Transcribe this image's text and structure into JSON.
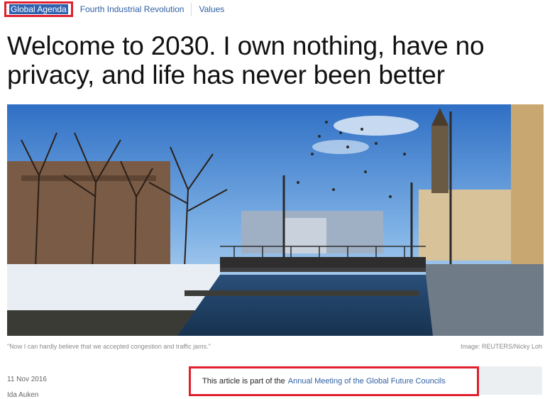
{
  "nav": {
    "items": [
      {
        "label": "Global Agenda"
      },
      {
        "label": "Fourth Industrial Revolution"
      },
      {
        "label": "Values"
      }
    ]
  },
  "article": {
    "title": "Welcome to 2030. I own nothing, have no privacy, and life has never been better",
    "image": {
      "caption": "\"Now I can hardly believe that we accepted congestion and traffic jams.\"",
      "credit": "Image: REUTERS/Nicky Loh"
    },
    "date": "11 Nov 2016",
    "author": "Ida Auken",
    "notice": {
      "lead": "This article is part of the",
      "link": "Annual Meeting of the Global Future Councils"
    }
  },
  "colors": {
    "link": "#2f5fa3",
    "highlight_border": "#e0202e"
  }
}
